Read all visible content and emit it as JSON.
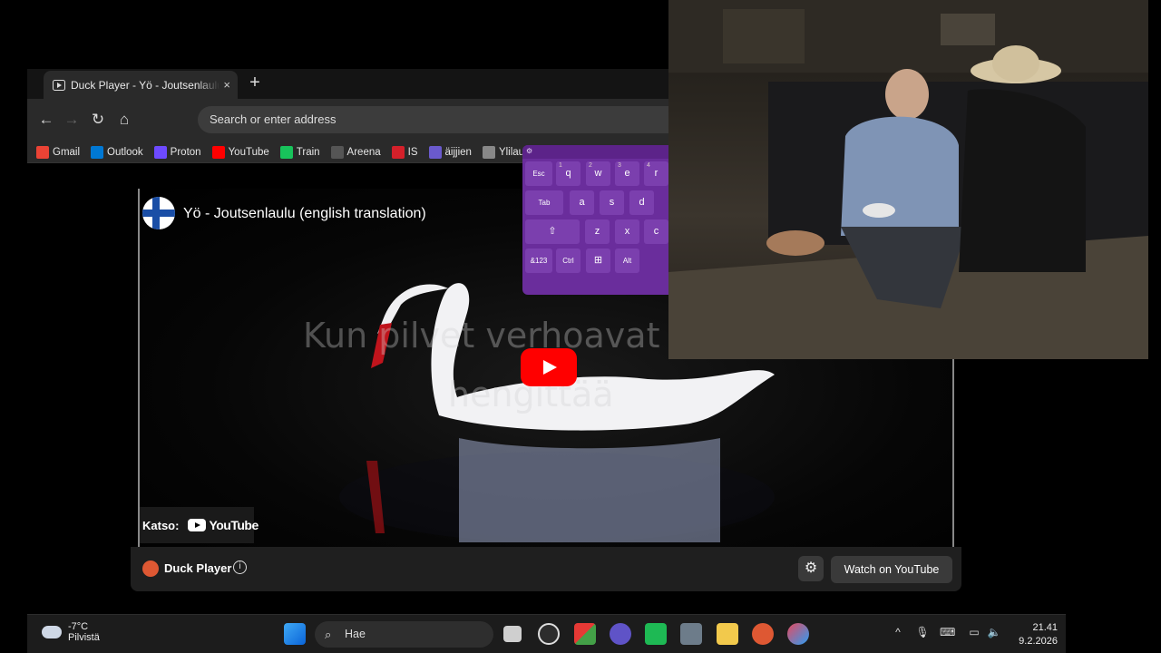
{
  "browser": {
    "tab_title": "Duck Player - Yö - Joutsenlaulu",
    "tab_close": "×",
    "new_tab": "+",
    "address_placeholder": "Search or enter address",
    "bookmarks": [
      {
        "label": "Gmail",
        "icon": "gmail-icon",
        "color": "#ea4335"
      },
      {
        "label": "Outlook",
        "icon": "outlook-icon",
        "color": "#0078d4"
      },
      {
        "label": "Proton",
        "icon": "proton-icon",
        "color": "#6d4aff"
      },
      {
        "label": "YouTube",
        "icon": "youtube-icon",
        "color": "#ff0000"
      },
      {
        "label": "Train",
        "icon": "train-icon",
        "color": "#18c35b"
      },
      {
        "label": "Areena",
        "icon": "areena-icon",
        "color": "#555555"
      },
      {
        "label": "IS",
        "icon": "is-icon",
        "color": "#d4202a"
      },
      {
        "label": "äijjien",
        "icon": "aijjien-icon",
        "color": "#6a5acd"
      },
      {
        "label": "Ylilauta",
        "icon": "ylilauta-icon",
        "color": "#888888"
      }
    ]
  },
  "player": {
    "video_title": "Yö - Joutsenlaulu (english translation)",
    "lyrics_line1": "Kun pilvet verhoavat sittä",
    "lyrics_line2": "hengittää",
    "watch_on_label": "Katso:",
    "youtube_wordmark": "YouTube",
    "duck_player_label": "Duck Player",
    "info_symbol": "i",
    "watch_button": "Watch on YouTube"
  },
  "keyboard": {
    "rows": [
      [
        "Esc",
        "q",
        "w",
        "e",
        "r"
      ],
      [
        "Tab",
        "a",
        "s",
        "d"
      ],
      [
        "⇧",
        "z",
        "x",
        "c"
      ],
      [
        "&123",
        "Ctrl",
        "⊞",
        "Alt"
      ]
    ],
    "number_hints": [
      "1",
      "2",
      "3",
      "4"
    ]
  },
  "taskbar": {
    "temperature": "-7°C",
    "weather_desc": "Pilvistä",
    "search_placeholder": "Hae",
    "time": "21.41",
    "date": "9.2.2026"
  }
}
